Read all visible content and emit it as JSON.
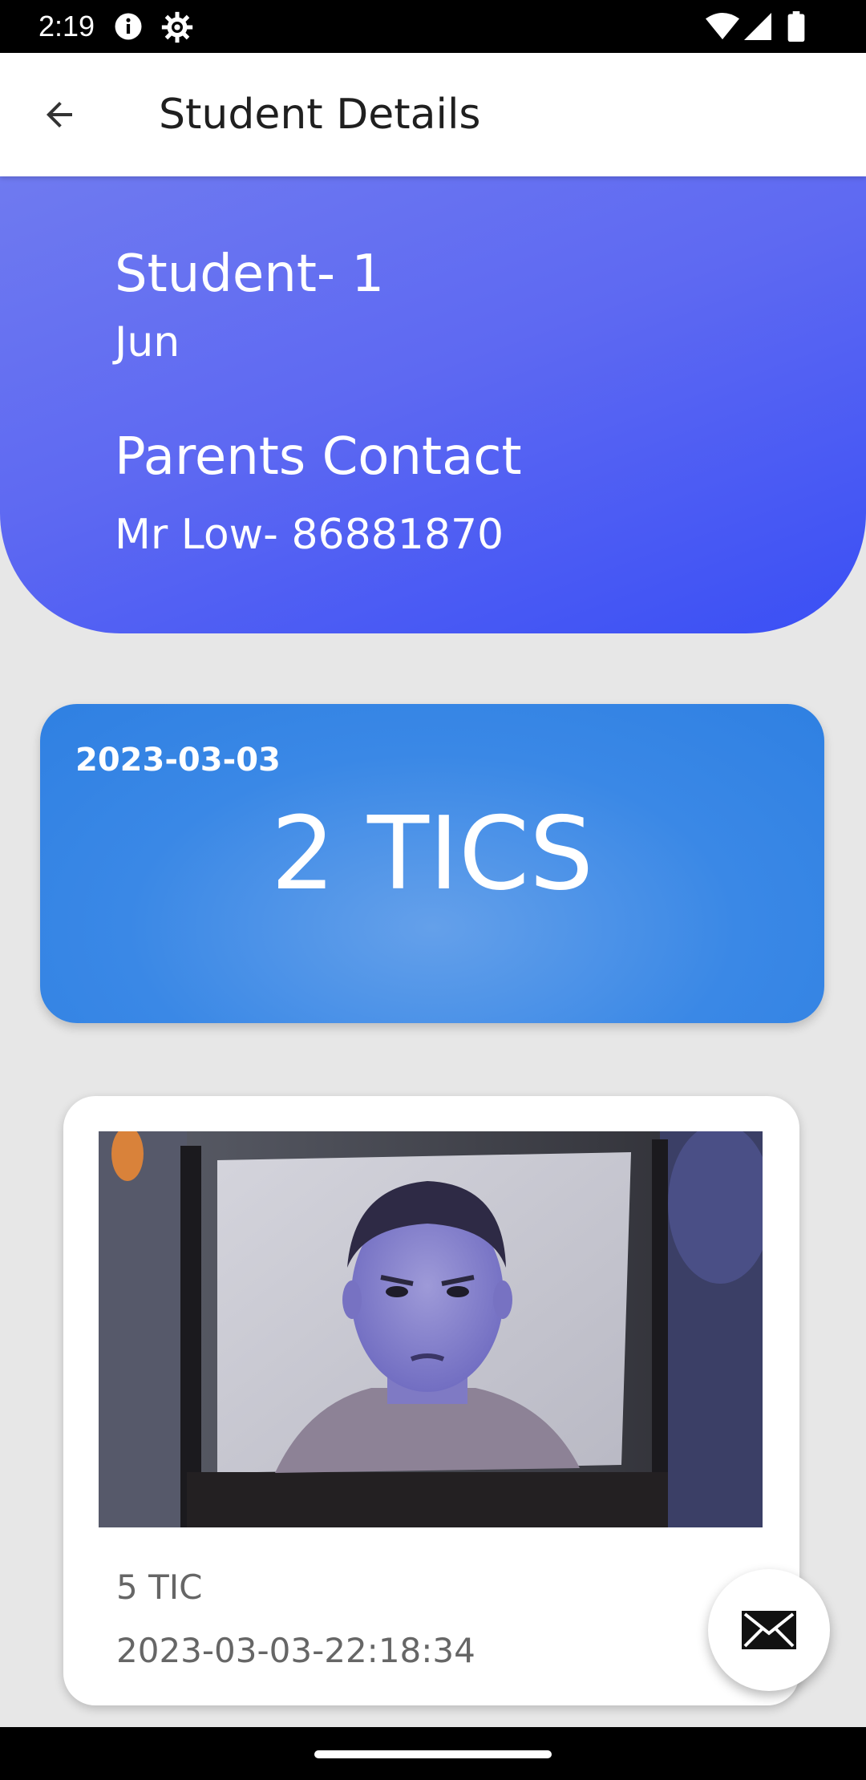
{
  "status_bar": {
    "time": "2:19",
    "icons": [
      "info-icon",
      "settings-icon",
      "wifi-icon",
      "cell-signal-icon",
      "battery-icon"
    ]
  },
  "app_bar": {
    "back_icon": "arrow-back-icon",
    "title": "Student Details"
  },
  "student": {
    "name": "Student- 1",
    "subtitle": "Jun",
    "contact_heading": "Parents Contact",
    "contact_value": "Mr Low-  86881870"
  },
  "tics_summary": {
    "date": "2023-03-03",
    "count_label": "2 TICS"
  },
  "record": {
    "tic_label": "5 TIC",
    "timestamp": "2023-03-03-22:18:34"
  },
  "fab": {
    "icon": "mail-icon"
  },
  "colors": {
    "header_gradient_start": "#6f7af0",
    "header_gradient_end": "#3a4ff5",
    "tics_card": "#3a88e6",
    "background": "#e7e7e7"
  }
}
